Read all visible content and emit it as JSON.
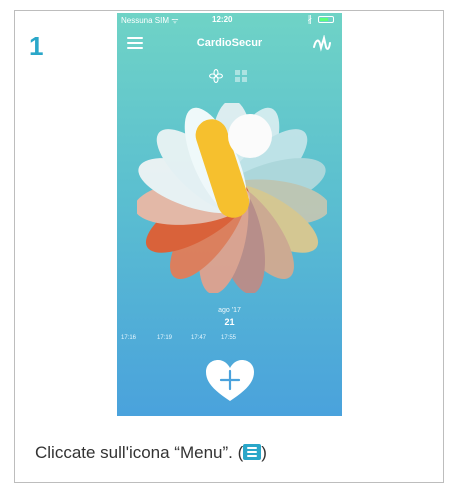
{
  "step": {
    "number": "1"
  },
  "status_bar": {
    "carrier": "Nessuna SIM ᯤ",
    "time": "12:20",
    "bluetooth": "∦"
  },
  "app": {
    "title": "CardioSecur",
    "icons": {
      "menu": "menu-icon",
      "ecg": "ecg-icon",
      "flower": "flower-icon",
      "grid": "grid-icon",
      "add": "heart-plus-icon"
    }
  },
  "timeline": {
    "month": "ago '17",
    "day": "21",
    "times": [
      "17:16",
      "17:19",
      "17:47",
      "17:55"
    ]
  },
  "caption": {
    "text": "Cliccate sull'icona “Menu”. (",
    "close": ")"
  },
  "colors": {
    "accent": "#2aa7c9",
    "phone_top": "#6fd3c6",
    "phone_bottom": "#4aa2dc"
  }
}
